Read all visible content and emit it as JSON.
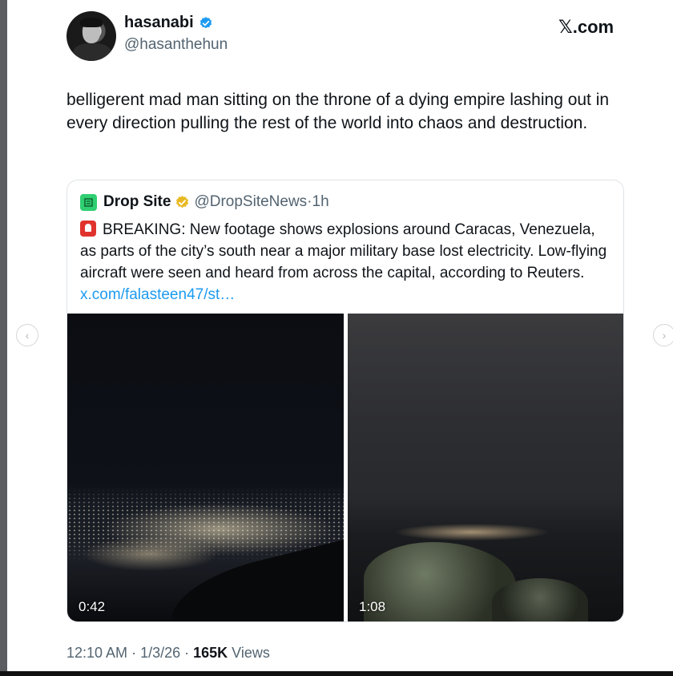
{
  "author": {
    "name": "hasanabi",
    "handle": "@hasanthehun",
    "verified_color": "#1d9bf0"
  },
  "site_label": "𝕏.com",
  "tweet": {
    "text": "belligerent mad man sitting on the throne of a dying empire lashing out in every direction pulling the rest of the world into chaos and destruction."
  },
  "quoted": {
    "name": "Drop Site",
    "handle": "@DropSiteNews",
    "separator": "·",
    "time": "1h",
    "badge_color": "#e8b923",
    "text": "BREAKING: New footage shows explosions around Caracas, Venezuela, as parts of the city’s south near a major military base lost electricity. Low-flying aircraft were seen and heard from across the capital, according to Reuters.",
    "link": "x.com/falasteen47/st…",
    "media": [
      {
        "duration": "0:42"
      },
      {
        "duration": "1:08"
      }
    ]
  },
  "meta": {
    "time": "12:10 AM",
    "date": "1/3/26",
    "views_count": "165K",
    "views_label": "Views"
  },
  "carousel": {
    "prev_icon": "‹",
    "next_icon": "›"
  }
}
